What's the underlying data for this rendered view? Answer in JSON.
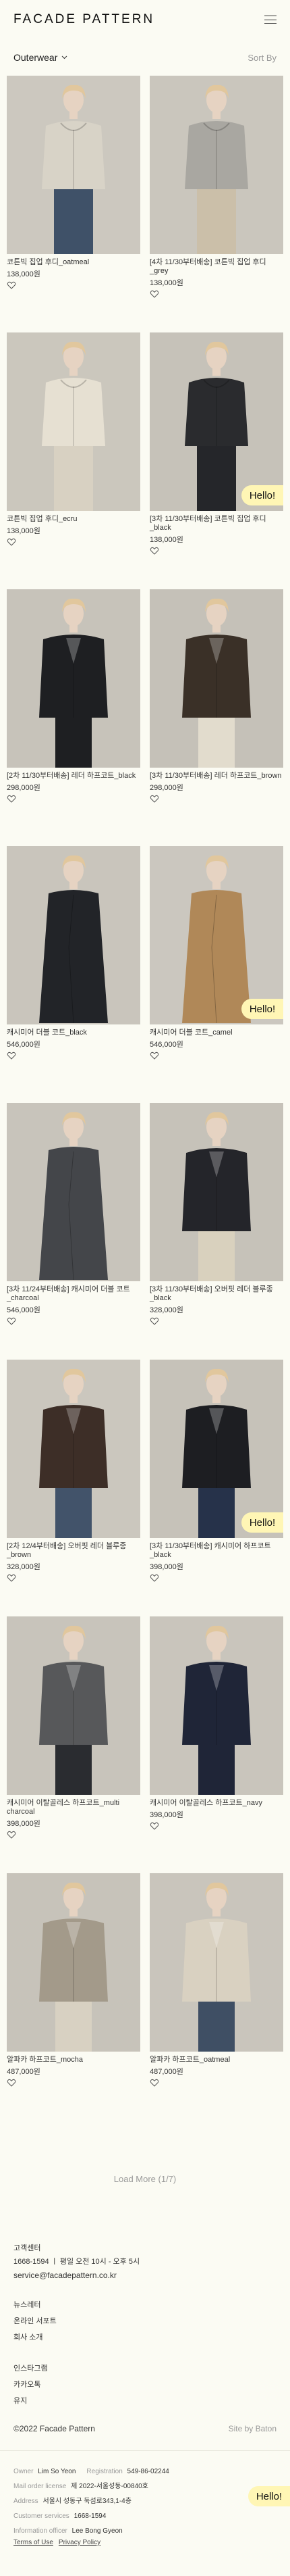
{
  "header": {
    "logo": "FACADE PATTERN",
    "menu_icon": "hamburger-icon"
  },
  "filter": {
    "category": "Outerwear",
    "sort": "Sort By"
  },
  "products": [
    {
      "name": "코튼빅 집업 후디_oatmeal",
      "price": "138,000원",
      "bg": "#ccc8bf",
      "cloth": "#d8d3c7",
      "pants": "#3f5168",
      "style": "hood"
    },
    {
      "name": "[4차 11/30부터배송] 코튼빅 집업 후디_grey",
      "price": "138,000원",
      "bg": "#cac6bd",
      "cloth": "#a9a7a1",
      "pants": "#cbbfa9",
      "style": "hood"
    },
    {
      "name": "코튼빅 집업 후디_ecru",
      "price": "138,000원",
      "bg": "#cbc7bd",
      "cloth": "#e6e0d2",
      "pants": "#d8d1c2",
      "style": "hood"
    },
    {
      "name": "[3차 11/30부터배송] 코튼빅 집업 후디_black",
      "price": "138,000원",
      "bg": "#c6c2b9",
      "cloth": "#2a2b2e",
      "pants": "#25262a",
      "style": "hood"
    },
    {
      "name": "[2차 11/30부터배송] 레더 하프코트_black",
      "price": "298,000원",
      "bg": "#c7c3ba",
      "cloth": "#1e1f22",
      "pants": "#1e1f22",
      "style": "coat"
    },
    {
      "name": "[3차 11/30부터배송] 레더 하프코트_brown",
      "price": "298,000원",
      "bg": "#c5c1b8",
      "cloth": "#3a3027",
      "pants": "#e2dccd",
      "style": "coat"
    },
    {
      "name": "캐시미어 더블 코트_black",
      "price": "546,000원",
      "bg": "#c9c5bc",
      "cloth": "#222428",
      "pants": "#222428",
      "style": "long"
    },
    {
      "name": "캐시미어 더블 코트_camel",
      "price": "546,000원",
      "bg": "#cbc7bf",
      "cloth": "#b08858",
      "pants": "#b08858",
      "style": "long"
    },
    {
      "name": "[3차 11/24부터배송] 캐시미어 더블 코트_charcoal",
      "price": "546,000원",
      "bg": "#c8c4bb",
      "cloth": "#44464a",
      "pants": "#44464a",
      "style": "long"
    },
    {
      "name": "[3차 11/30부터배송] 오버핏 레더 블루종_black",
      "price": "328,000원",
      "bg": "#c6c2b9",
      "cloth": "#24252a",
      "pants": "#d9d1be",
      "style": "coat"
    },
    {
      "name": "[2차 12/4부터배송] 오버핏 레더 블루종_brown",
      "price": "328,000원",
      "bg": "#cbc7be",
      "cloth": "#3d2e27",
      "pants": "#42536a",
      "style": "coat"
    },
    {
      "name": "[3차 11/30부터배송] 캐시미어 하프코트_black",
      "price": "398,000원",
      "bg": "#c6c2b9",
      "cloth": "#1d1e22",
      "pants": "#26324a",
      "style": "coat"
    },
    {
      "name": "캐시미어 이탈골레스 하프코트_multi charcoal",
      "price": "398,000원",
      "bg": "#c8c4bb",
      "cloth": "#57585a",
      "pants": "#2a2c30",
      "style": "coat"
    },
    {
      "name": "캐시미어 이탈골레스 하프코트_navy",
      "price": "398,000원",
      "bg": "#c9c5bc",
      "cloth": "#1f2537",
      "pants": "#1f2537",
      "style": "coat"
    },
    {
      "name": "알파카 하프코트_mocha",
      "price": "487,000원",
      "bg": "#c7c3ba",
      "cloth": "#a39a8a",
      "pants": "#d8d1c2",
      "style": "coat"
    },
    {
      "name": "알파카 하프코트_oatmeal",
      "price": "487,000원",
      "bg": "#c9c5bc",
      "cloth": "#d9d1c1",
      "pants": "#3f4f64",
      "style": "coat"
    }
  ],
  "badge": "Hello!",
  "load_more": "Load More (1/7)",
  "footer": {
    "cs_title": "고객센터",
    "cs_phone": "1668-1594 ㅣ 평일 오전 10시 - 오후 5시",
    "cs_email": "service@facadepattern.co.kr",
    "nav1": [
      "뉴스레터",
      "온라인 서포트",
      "회사 소개"
    ],
    "nav2": [
      "인스타그램",
      "카카오톡",
      "유지"
    ],
    "copyright": "©2022 Facade Pattern",
    "site_by": "Site by Baton",
    "biz": [
      {
        "label": "Owner",
        "value": "Lim So Yeon",
        "label2": "Registration",
        "value2": "549-86-02244"
      },
      {
        "label": "Mail order license",
        "value": "제 2022-서울성동-00840호"
      },
      {
        "label": "Address",
        "value": "서울시 성동구 둑섬로343,1-4층"
      },
      {
        "label": "Customer services",
        "value": "1668-1594"
      },
      {
        "label": "Information officer",
        "value": "Lee Bong Gyeon"
      }
    ],
    "links": [
      "Terms of Use",
      "Privacy Policy"
    ]
  }
}
